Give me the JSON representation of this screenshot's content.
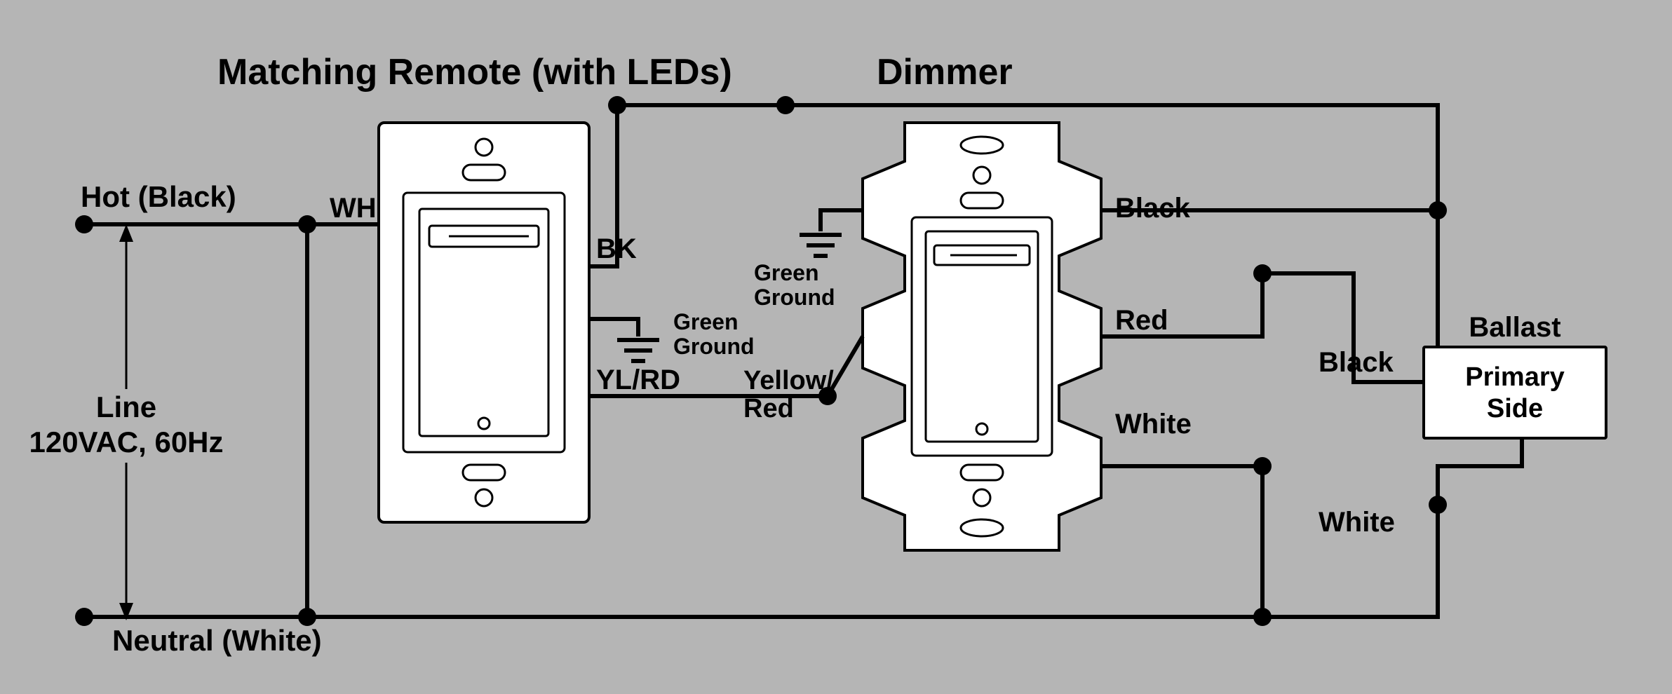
{
  "titles": {
    "remote": "Matching Remote (with LEDs)",
    "dimmer": "Dimmer"
  },
  "leftSupply": {
    "hot": "Hot (Black)",
    "line1": "Line",
    "line2": "120VAC, 60Hz",
    "neutral": "Neutral (White)"
  },
  "remoteTerminals": {
    "wh": "WH",
    "bk": "BK",
    "ylrd": "YL/RD",
    "ground1": "Green",
    "ground2": "Ground"
  },
  "dimmerTerminals": {
    "yellowRed1": "Yellow/",
    "yellowRed2": "Red",
    "ground1": "Green",
    "ground2": "Ground",
    "black": "Black",
    "red": "Red",
    "white": "White"
  },
  "ballast": {
    "title": "Ballast",
    "line1": "Primary",
    "line2": "Side",
    "blackIn": "Black",
    "whiteIn": "White"
  }
}
